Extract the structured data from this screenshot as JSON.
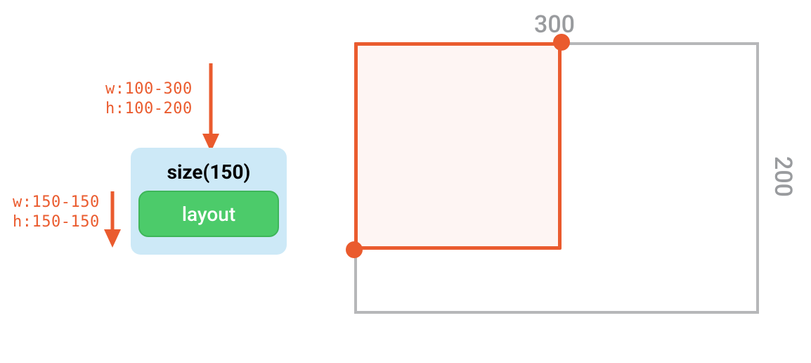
{
  "arrows": {
    "incoming": {
      "w_label": "w:100-300",
      "h_label": "h:100-200"
    },
    "outgoing": {
      "w_label": "w:150-150",
      "h_label": "h:150-150"
    }
  },
  "node": {
    "title": "size(150)",
    "child_label": "layout"
  },
  "layout": {
    "max_w_label": "300",
    "max_h_label": "200",
    "max_w": 300,
    "max_h": 200,
    "result_w": 150,
    "result_h": 150
  },
  "colors": {
    "accent": "#EA5B2E",
    "node_bg": "#CDE9F7",
    "child_bg": "#4CCB6A",
    "gray": "#B6B7B9"
  }
}
